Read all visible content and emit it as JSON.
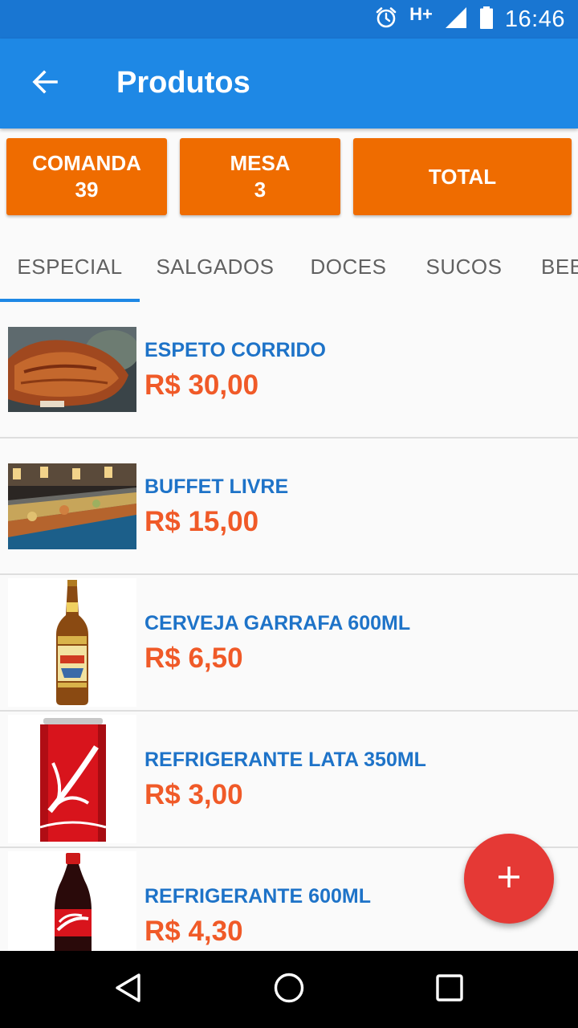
{
  "status_bar": {
    "time": "16:46",
    "network": "H+",
    "icons": [
      "alarm-icon",
      "signal-icon",
      "battery-icon"
    ]
  },
  "app_bar": {
    "title": "Produtos",
    "back_icon": "arrow-left-icon"
  },
  "summary": {
    "comanda_label": "COMANDA",
    "comanda_value": "39",
    "mesa_label": "MESA",
    "mesa_value": "3",
    "total_label": "TOTAL"
  },
  "tabs": [
    {
      "label": "ESPECIAL",
      "selected": true
    },
    {
      "label": "SALGADOS",
      "selected": false
    },
    {
      "label": "DOCES",
      "selected": false
    },
    {
      "label": "SUCOS",
      "selected": false
    },
    {
      "label": "BEB",
      "selected": false
    }
  ],
  "products": [
    {
      "name": "ESPETO CORRIDO",
      "price": "R$ 30,00",
      "image": "grilled-meat"
    },
    {
      "name": "BUFFET LIVRE",
      "price": "R$ 15,00",
      "image": "buffet-counter"
    },
    {
      "name": "CERVEJA GARRAFA 600ML",
      "price": "R$ 6,50",
      "image": "beer-bottle"
    },
    {
      "name": "REFRIGERANTE LATA 350ML",
      "price": "R$ 3,00",
      "image": "soda-can"
    },
    {
      "name": "REFRIGERANTE 600ML",
      "price": "R$ 4,30",
      "image": "soda-bottle"
    }
  ],
  "fab": {
    "icon": "plus-icon"
  },
  "nav_bar": {
    "icons": [
      "back-triangle-icon",
      "home-circle-icon",
      "recents-square-icon"
    ]
  },
  "colors": {
    "status_bar": "#1976d2",
    "app_bar": "#1e88e5",
    "summary_button": "#ef6c00",
    "product_name": "#1e73c8",
    "product_price": "#f05a28",
    "fab": "#e53935",
    "tab_indicator": "#1e88e5"
  }
}
